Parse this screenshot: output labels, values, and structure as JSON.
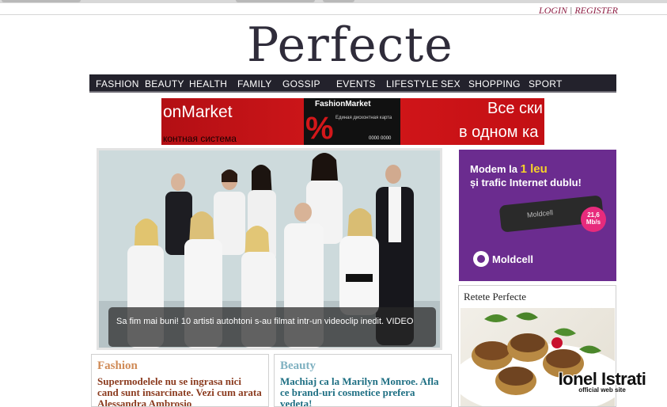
{
  "header": {
    "login_label": "LOGIN",
    "separator": "|",
    "register_label": "REGISTER",
    "logo_text": "Perfecte"
  },
  "nav": {
    "items": [
      "FASHION",
      "BEAUTY",
      "HEALTH",
      "FAMILY",
      "GOSSIP",
      "EVENTS",
      "LIFESTYLE",
      "SEX",
      "SHOPPING",
      "SPORT"
    ]
  },
  "banner": {
    "left_text": "onMarket",
    "left_sub": "контная система",
    "card_title": "FashionMarket",
    "card_pct": "%",
    "card_sub": "Единая дисконтная карта",
    "card_number": "0000 0000",
    "right_line1": "Все ски",
    "right_line2": "в одном ка"
  },
  "feature": {
    "caption": "Sa fim mai buni! 10 artisti autohtoni s-au filmat intr-un videoclip inedit. VIDEO"
  },
  "ad": {
    "line1_prefix": "Modem la",
    "line1_accent": "1 leu",
    "line2": "și trafic Internet dublu!",
    "speed_value": "21,6",
    "speed_unit": "Mb/s",
    "modem_brand": "Moldcell",
    "brand": "Moldcell",
    "colors": {
      "background": "#6b2c8f",
      "accent": "#f6d229",
      "badge": "#e72b7c"
    }
  },
  "retete": {
    "title": "Retete Perfecte"
  },
  "watermark": {
    "name": "Ionel Istrati",
    "sub": "official web site"
  },
  "boxes": {
    "fashion": {
      "title": "Fashion",
      "text": "Supermodelele nu se ingrasa nici cand sunt insarcinate. Vezi cum arata Alessandra Ambrosio"
    },
    "beauty": {
      "title": "Beauty",
      "text": "Machiaj ca la Marilyn Monroe. Afla ce brand-uri cosmetice prefera vedeta!"
    }
  }
}
